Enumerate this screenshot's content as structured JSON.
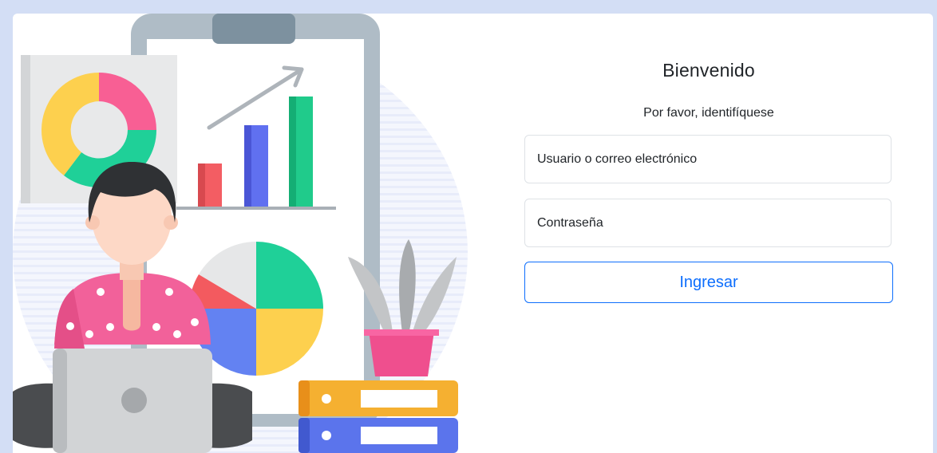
{
  "login": {
    "title": "Bienvenido",
    "subtitle": "Por favor, identifíquese",
    "username_placeholder": "Usuario o correo electrónico",
    "password_placeholder": "Contraseña",
    "submit_label": "Ingresar"
  },
  "colors": {
    "page_background": "#d3def5",
    "primary": "#0d6efd",
    "field_border": "#dee2e6",
    "text": "#212529"
  },
  "illustration": {
    "icon": "dashboard-analytics-person-with-laptop"
  }
}
